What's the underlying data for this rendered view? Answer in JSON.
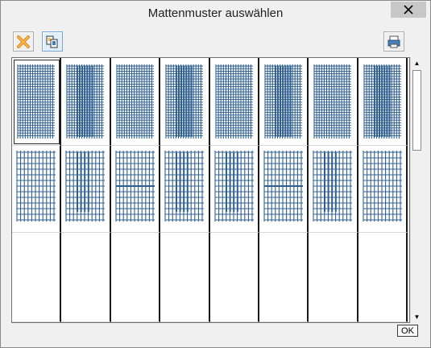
{
  "window": {
    "title": "Mattenmuster auswählen"
  },
  "toolbar": {
    "delete_icon": "delete-x-icon",
    "copy_icon": "copy-icon",
    "print_icon": "print-icon"
  },
  "patterns": {
    "rows": [
      [
        "dense-mesh-1",
        "dense-mesh-2",
        "dense-mesh-3",
        "dense-mesh-4",
        "dense-mesh-5",
        "dense-mesh-6",
        "dense-mesh-7",
        "dense-mesh-8"
      ],
      [
        "open-mesh-1",
        "open-mesh-2",
        "open-mesh-3",
        "open-mesh-4",
        "open-mesh-5",
        "open-mesh-6",
        "open-mesh-7",
        "open-mesh-8"
      ],
      [
        "",
        "",
        "",
        "",
        "",
        "",
        "",
        ""
      ]
    ],
    "selected": "dense-mesh-1"
  },
  "buttons": {
    "ok_label": "OK"
  },
  "colors": {
    "mesh": "#2f5f8f",
    "selection": "#2b2b2b"
  }
}
